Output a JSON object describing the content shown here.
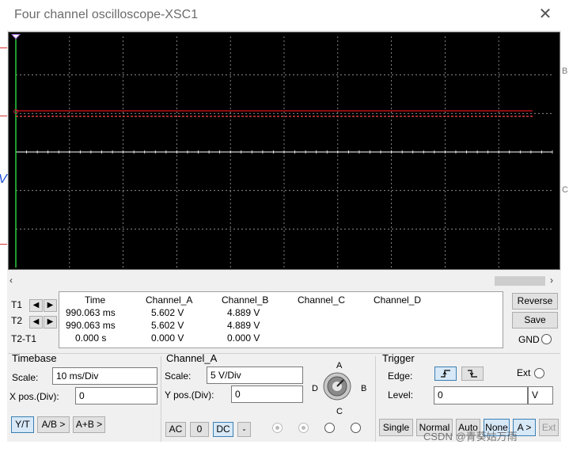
{
  "window": {
    "title": "Four channel oscilloscope-XSC1",
    "close_glyph": "✕"
  },
  "side_marks": {
    "right_b": "B",
    "right_c": "C",
    "left_v": "V"
  },
  "readout": {
    "headers": [
      "Time",
      "Channel_A",
      "Channel_B",
      "Channel_C",
      "Channel_D"
    ],
    "rows": [
      {
        "label": "T1",
        "time": "990.063 ms",
        "a": "5.602 V",
        "b": "4.889 V"
      },
      {
        "label": "T2",
        "time": "990.063 ms",
        "a": "5.602 V",
        "b": "4.889 V"
      },
      {
        "label": "T2-T1",
        "time": "0.000 s",
        "a": "0.000 V",
        "b": "0.000 V"
      }
    ],
    "arrow_left": "◀",
    "arrow_right": "▶"
  },
  "right_panel": {
    "reverse": "Reverse",
    "save": "Save",
    "gnd": "GND"
  },
  "timebase": {
    "title": "Timebase",
    "scale_label": "Scale:",
    "scale_value": "10 ms/Div",
    "xpos_label": "X pos.(Div):",
    "xpos_value": "0",
    "modes": [
      "Y/T",
      "A/B >",
      "A+B >"
    ],
    "active_mode": "Y/T"
  },
  "channel": {
    "title": "Channel_A",
    "scale_label": "Scale:",
    "scale_value": "5  V/Div",
    "ypos_label": "Y pos.(Div):",
    "ypos_value": "0",
    "coupling": [
      "AC",
      "0",
      "DC",
      "-"
    ],
    "active_coupling": "DC",
    "knob_labels": {
      "a": "A",
      "b": "B",
      "c": "C",
      "d": "D"
    }
  },
  "trigger": {
    "title": "Trigger",
    "edge_label": "Edge:",
    "ext_label": "Ext",
    "level_label": "Level:",
    "level_value": "0",
    "level_unit": "V",
    "modes": [
      "Single",
      "Normal",
      "Auto",
      "None",
      "A >",
      "Ext"
    ],
    "active_mode": "None"
  },
  "watermark": "CSDN @青葵姑万雨",
  "colors": {
    "screen_bg": "#000000",
    "trace_a": "#e0141e",
    "trace_b": "#ff4a4a",
    "cursor": "#2ecc40",
    "grid": "#a0a0a0",
    "active": "#3c7fb1"
  }
}
